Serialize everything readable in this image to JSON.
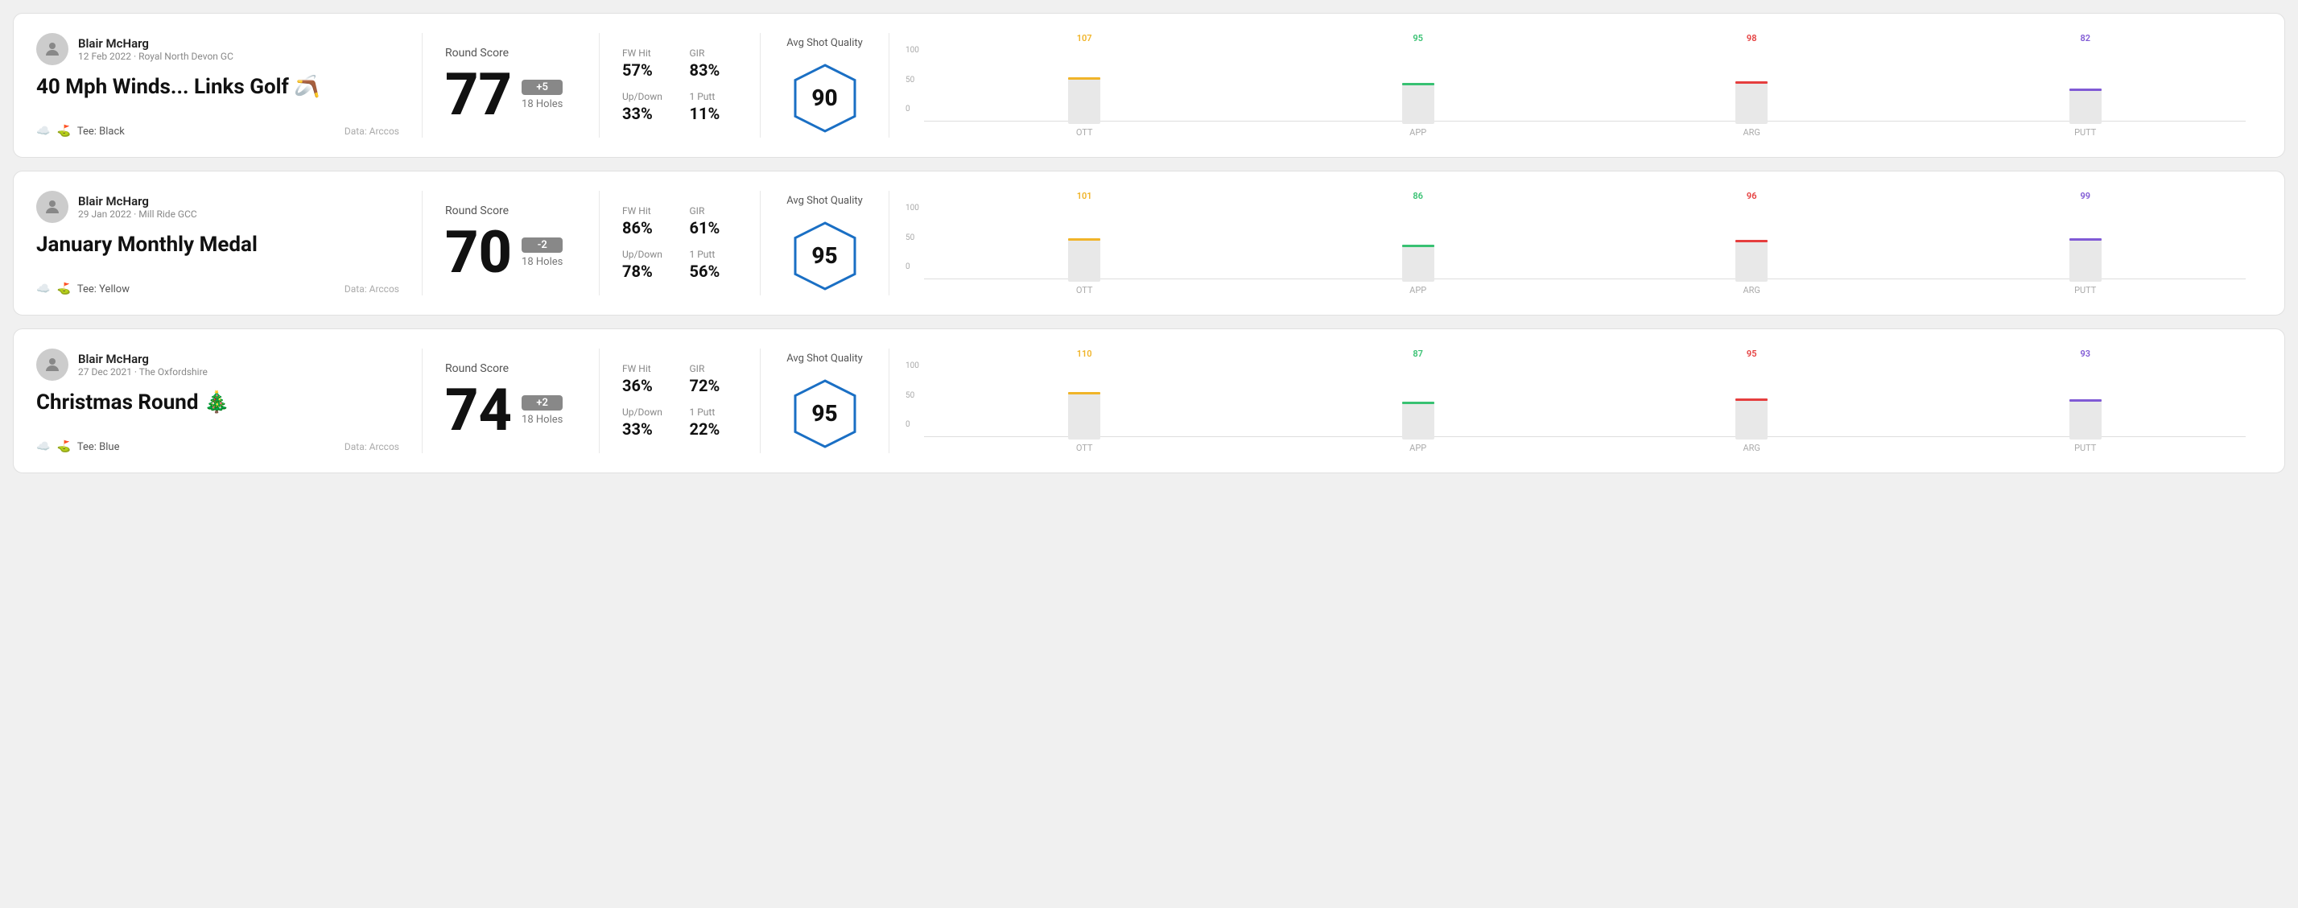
{
  "rounds": [
    {
      "id": "round1",
      "user": {
        "name": "Blair McHarg",
        "meta": "12 Feb 2022 · Royal North Devon GC"
      },
      "title": "40 Mph Winds... Links Golf 🪃",
      "tee": "Black",
      "data_source": "Data: Arccos",
      "score": {
        "label": "Round Score",
        "number": "77",
        "badge": "+5",
        "badge_type": "plus",
        "holes": "18 Holes"
      },
      "stats": {
        "fw_hit_label": "FW Hit",
        "fw_hit_value": "57%",
        "gir_label": "GIR",
        "gir_value": "83%",
        "updown_label": "Up/Down",
        "updown_value": "33%",
        "oneputt_label": "1 Putt",
        "oneputt_value": "11%"
      },
      "quality": {
        "label": "Avg Shot Quality",
        "score": "90"
      },
      "chart": {
        "bars": [
          {
            "label": "OTT",
            "value": 107,
            "color_class": "color-ott",
            "fill_class": "fill-ott",
            "height_pct": 72
          },
          {
            "label": "APP",
            "value": 95,
            "color_class": "color-app",
            "fill_class": "fill-app",
            "height_pct": 64
          },
          {
            "label": "ARG",
            "value": 98,
            "color_class": "color-arg",
            "fill_class": "fill-arg",
            "height_pct": 66
          },
          {
            "label": "PUTT",
            "value": 82,
            "color_class": "color-putt",
            "fill_class": "fill-putt",
            "height_pct": 55
          }
        ],
        "y_labels": [
          "100",
          "50",
          "0"
        ]
      }
    },
    {
      "id": "round2",
      "user": {
        "name": "Blair McHarg",
        "meta": "29 Jan 2022 · Mill Ride GCC"
      },
      "title": "January Monthly Medal",
      "tee": "Yellow",
      "data_source": "Data: Arccos",
      "score": {
        "label": "Round Score",
        "number": "70",
        "badge": "-2",
        "badge_type": "minus",
        "holes": "18 Holes"
      },
      "stats": {
        "fw_hit_label": "FW Hit",
        "fw_hit_value": "86%",
        "gir_label": "GIR",
        "gir_value": "61%",
        "updown_label": "Up/Down",
        "updown_value": "78%",
        "oneputt_label": "1 Putt",
        "oneputt_value": "56%"
      },
      "quality": {
        "label": "Avg Shot Quality",
        "score": "95"
      },
      "chart": {
        "bars": [
          {
            "label": "OTT",
            "value": 101,
            "color_class": "color-ott",
            "fill_class": "fill-ott",
            "height_pct": 68
          },
          {
            "label": "APP",
            "value": 86,
            "color_class": "color-app",
            "fill_class": "fill-app",
            "height_pct": 58
          },
          {
            "label": "ARG",
            "value": 96,
            "color_class": "color-arg",
            "fill_class": "fill-arg",
            "height_pct": 65
          },
          {
            "label": "PUTT",
            "value": 99,
            "color_class": "color-putt",
            "fill_class": "fill-putt",
            "height_pct": 67
          }
        ],
        "y_labels": [
          "100",
          "50",
          "0"
        ]
      }
    },
    {
      "id": "round3",
      "user": {
        "name": "Blair McHarg",
        "meta": "27 Dec 2021 · The Oxfordshire"
      },
      "title": "Christmas Round 🎄",
      "tee": "Blue",
      "data_source": "Data: Arccos",
      "score": {
        "label": "Round Score",
        "number": "74",
        "badge": "+2",
        "badge_type": "plus",
        "holes": "18 Holes"
      },
      "stats": {
        "fw_hit_label": "FW Hit",
        "fw_hit_value": "36%",
        "gir_label": "GIR",
        "gir_value": "72%",
        "updown_label": "Up/Down",
        "updown_value": "33%",
        "oneputt_label": "1 Putt",
        "oneputt_value": "22%"
      },
      "quality": {
        "label": "Avg Shot Quality",
        "score": "95"
      },
      "chart": {
        "bars": [
          {
            "label": "OTT",
            "value": 110,
            "color_class": "color-ott",
            "fill_class": "fill-ott",
            "height_pct": 74
          },
          {
            "label": "APP",
            "value": 87,
            "color_class": "color-app",
            "fill_class": "fill-app",
            "height_pct": 59
          },
          {
            "label": "ARG",
            "value": 95,
            "color_class": "color-arg",
            "fill_class": "fill-arg",
            "height_pct": 64
          },
          {
            "label": "PUTT",
            "value": 93,
            "color_class": "color-putt",
            "fill_class": "fill-putt",
            "height_pct": 63
          }
        ],
        "y_labels": [
          "100",
          "50",
          "0"
        ]
      }
    }
  ]
}
